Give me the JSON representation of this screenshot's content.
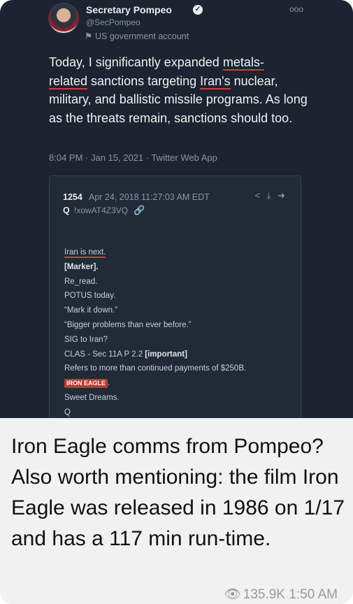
{
  "tweet": {
    "author_name": "Secretary Pompeo",
    "handle": "@SecPompeo",
    "gov_label": "US government account",
    "text_parts": [
      "Today, I significantly expanded ",
      "metals-\nrelated",
      " sanctions targeting ",
      "Iran's",
      " nuclear, military, and ballistic missile programs. As long as the threats remain, sanctions should too."
    ],
    "meta": "8:04 PM · Jan 15, 2021 · Twitter Web App",
    "icons": {
      "verified": "verified-icon",
      "more": "more-icon",
      "flag": "flag-icon"
    }
  },
  "qpost": {
    "number": "1254",
    "date": "Apr 24, 2018 11:27:03 AM EDT",
    "q": "Q",
    "trip": "!xowAT4Z3VQ",
    "lines": [
      "Iran is next.",
      "[Marker].",
      "Re_read.",
      "POTUS today.",
      "“Mark it down.”",
      "“Bigger problems than ever before.”",
      "SIG to Iran?",
      "CLAS - Sec 11A P 2.2 ",
      "[important]",
      "Refers to more than continued payments of $250B.",
      "IRON EAGLE",
      ".",
      "Sweet Dreams.",
      "Q"
    ],
    "icons": [
      "share-icon",
      "download-icon",
      "arrow-icon",
      "link-icon"
    ]
  },
  "message": {
    "caption": "Iron Eagle comms from Pompeo? Also worth mentioning: the film Iron Eagle was released in 1986 on 1/17 and has a 117 min run-time.",
    "views": "135.9K",
    "time": "1:50 AM"
  },
  "colors": {
    "screenshot_bg": "#1b2430",
    "underline": "#d63a3a",
    "badge": "#c0392b",
    "caption_text": "#111111"
  }
}
